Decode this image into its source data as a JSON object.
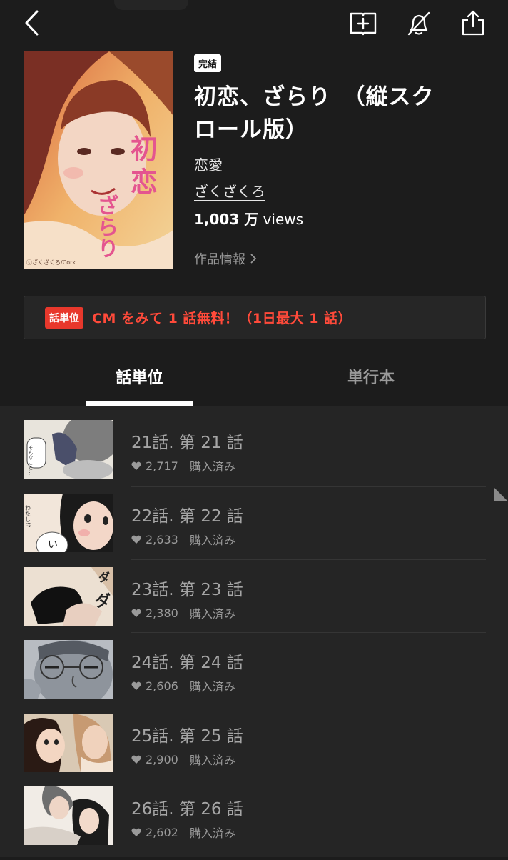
{
  "header": {
    "status_badge": "完結",
    "title_line1": "初恋、ざらり　（縦スク",
    "title_line2": "ロール版）",
    "genre": "恋愛",
    "author": "ざくざくろ",
    "views_number": "1,003 万",
    "views_unit": " views",
    "work_info": "作品情報",
    "cover_title": "初恋、ざらり",
    "cover_credit": "ⓒざくざくろ/Cork"
  },
  "promo": {
    "tag": "話単位",
    "text": "CM をみて 1 話無料！（1日最大 1 話）"
  },
  "tabs": [
    "話単位",
    "単行本"
  ],
  "episodes": [
    {
      "title": "21話. 第 21 話",
      "likes": "2,717",
      "status": "購入済み",
      "thumb_text": "そんなこと…"
    },
    {
      "title": "22話. 第 22 話",
      "likes": "2,633",
      "status": "購入済み",
      "thumb_text": "わたし!?"
    },
    {
      "title": "23話. 第 23 話",
      "likes": "2,380",
      "status": "購入済み",
      "thumb_text": "ダ"
    },
    {
      "title": "24話. 第 24 話",
      "likes": "2,606",
      "status": "購入済み",
      "thumb_text": ""
    },
    {
      "title": "25話. 第 25 話",
      "likes": "2,900",
      "status": "購入済み",
      "thumb_text": ""
    },
    {
      "title": "26話. 第 26 話",
      "likes": "2,602",
      "status": "購入済み",
      "thumb_text": ""
    }
  ],
  "colors": {
    "accent_red": "#e8382c",
    "background": "#1c1c1c",
    "list_background": "#252525"
  }
}
